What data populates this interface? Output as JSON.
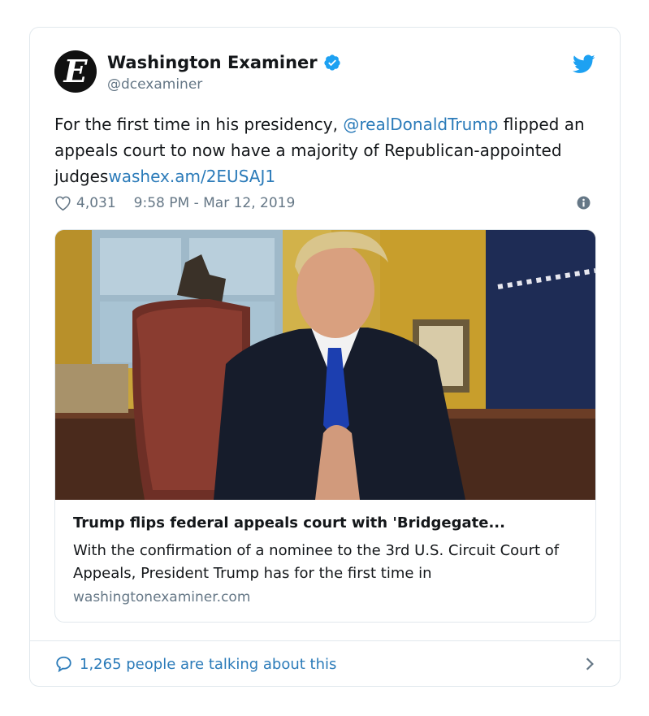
{
  "account": {
    "avatar_letter": "E",
    "name": "Washington Examiner",
    "handle": "@dcexaminer",
    "verified": true
  },
  "tweet": {
    "text_before": "For the first time in his presidency, ",
    "mention": "@realDonaldTrump",
    "text_middle": " flipped an appeals court to now have a majority of Republican-appointed judges",
    "link": "washex.am/2EUSAJ1",
    "likes": "4,031",
    "timestamp": "9:58 PM - Mar 12, 2019"
  },
  "card": {
    "title": "Trump flips federal appeals court with 'Bridgegate...",
    "description": "With the confirmation of a nominee to the 3rd U.S. Circuit Court of Appeals, President Trump has for the first time in",
    "domain": "washingtonexaminer.com"
  },
  "footer": {
    "talking_label": "1,265 people are talking about this"
  },
  "icons": {
    "verified": "verified-badge-icon",
    "twitter": "twitter-bird-icon",
    "like": "heart-icon",
    "info": "info-icon",
    "reply": "speech-bubble-icon",
    "chevron": "chevron-right-icon"
  },
  "colors": {
    "link": "#2b7bb9",
    "twitter_blue": "#1da1f2",
    "muted": "#657786",
    "border": "#e1e8ed"
  }
}
